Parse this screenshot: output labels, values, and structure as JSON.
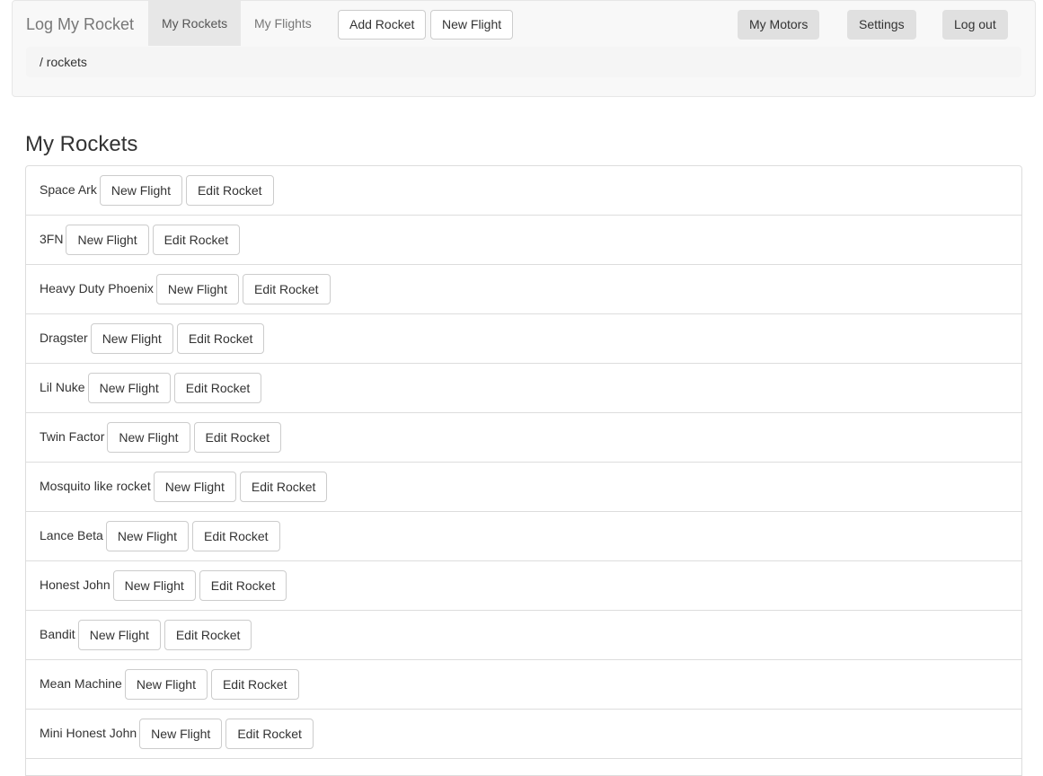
{
  "navbar": {
    "brand": "Log My Rocket",
    "links": {
      "my_rockets": "My Rockets",
      "my_flights": "My Flights"
    },
    "buttons": {
      "add_rocket": "Add Rocket",
      "new_flight": "New Flight",
      "my_motors": "My Motors",
      "settings": "Settings",
      "log_out": "Log out"
    }
  },
  "breadcrumb": "/ rockets",
  "page": {
    "title": "My Rockets",
    "new_flight_label": "New Flight",
    "edit_rocket_label": "Edit Rocket"
  },
  "rockets": [
    {
      "name": "Space Ark"
    },
    {
      "name": "3FN"
    },
    {
      "name": "Heavy Duty Phoenix"
    },
    {
      "name": "Dragster"
    },
    {
      "name": "Lil Nuke"
    },
    {
      "name": "Twin Factor"
    },
    {
      "name": "Mosquito like rocket"
    },
    {
      "name": "Lance Beta"
    },
    {
      "name": "Honest John"
    },
    {
      "name": "Bandit"
    },
    {
      "name": "Mean Machine"
    },
    {
      "name": "Mini Honest John"
    }
  ],
  "colors": {
    "navbar_bg": "#f8f8f8",
    "active_link_bg": "#e7e7e7",
    "grey_button_bg": "#e0e0e0",
    "border": "#dddddd"
  }
}
